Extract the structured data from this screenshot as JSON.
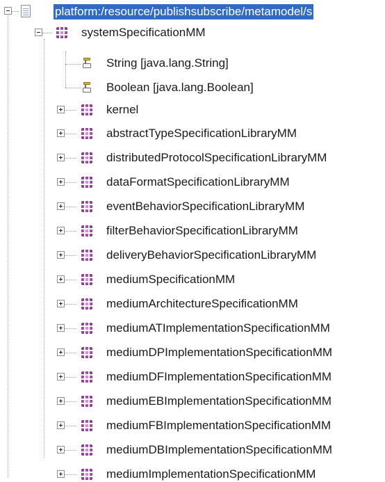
{
  "tree": {
    "root": {
      "label": "platform:/resource/publishsubscribe/metamodel/s",
      "icon": "file-icon",
      "expanded": true,
      "selected": true,
      "selection_color": "#316ac5"
    },
    "package": {
      "label": "systemSpecificationMM",
      "icon": "package-icon",
      "expanded": true
    },
    "datatypes": [
      {
        "label": "String [java.lang.String]",
        "icon": "datatype-icon"
      },
      {
        "label": "Boolean [java.lang.Boolean]",
        "icon": "datatype-icon"
      }
    ],
    "subpackages": [
      {
        "label": "kernel",
        "icon": "package-icon",
        "expanded": false
      },
      {
        "label": "abstractTypeSpecificationLibraryMM",
        "icon": "package-icon",
        "expanded": false
      },
      {
        "label": "distributedProtocolSpecificationLibraryMM",
        "icon": "package-icon",
        "expanded": false
      },
      {
        "label": "dataFormatSpecificationLibraryMM",
        "icon": "package-icon",
        "expanded": false
      },
      {
        "label": "eventBehaviorSpecificationLibraryMM",
        "icon": "package-icon",
        "expanded": false
      },
      {
        "label": "filterBehaviorSpecificationLibraryMM",
        "icon": "package-icon",
        "expanded": false
      },
      {
        "label": "deliveryBehaviorSpecificationLibraryMM",
        "icon": "package-icon",
        "expanded": false
      },
      {
        "label": "mediumSpecificationMM",
        "icon": "package-icon",
        "expanded": false
      },
      {
        "label": "mediumArchitectureSpecificationMM",
        "icon": "package-icon",
        "expanded": false
      },
      {
        "label": "mediumATImplementationSpecificationMM",
        "icon": "package-icon",
        "expanded": false
      },
      {
        "label": "mediumDPImplementationSpecificationMM",
        "icon": "package-icon",
        "expanded": false
      },
      {
        "label": "mediumDFImplementationSpecificationMM",
        "icon": "package-icon",
        "expanded": false
      },
      {
        "label": "mediumEBImplementationSpecificationMM",
        "icon": "package-icon",
        "expanded": false
      },
      {
        "label": "mediumFBImplementationSpecificationMM",
        "icon": "package-icon",
        "expanded": false
      },
      {
        "label": "mediumDBImplementationSpecificationMM",
        "icon": "package-icon",
        "expanded": false
      },
      {
        "label": "mediumImplementationSpecificationMM",
        "icon": "package-icon",
        "expanded": false
      }
    ]
  }
}
